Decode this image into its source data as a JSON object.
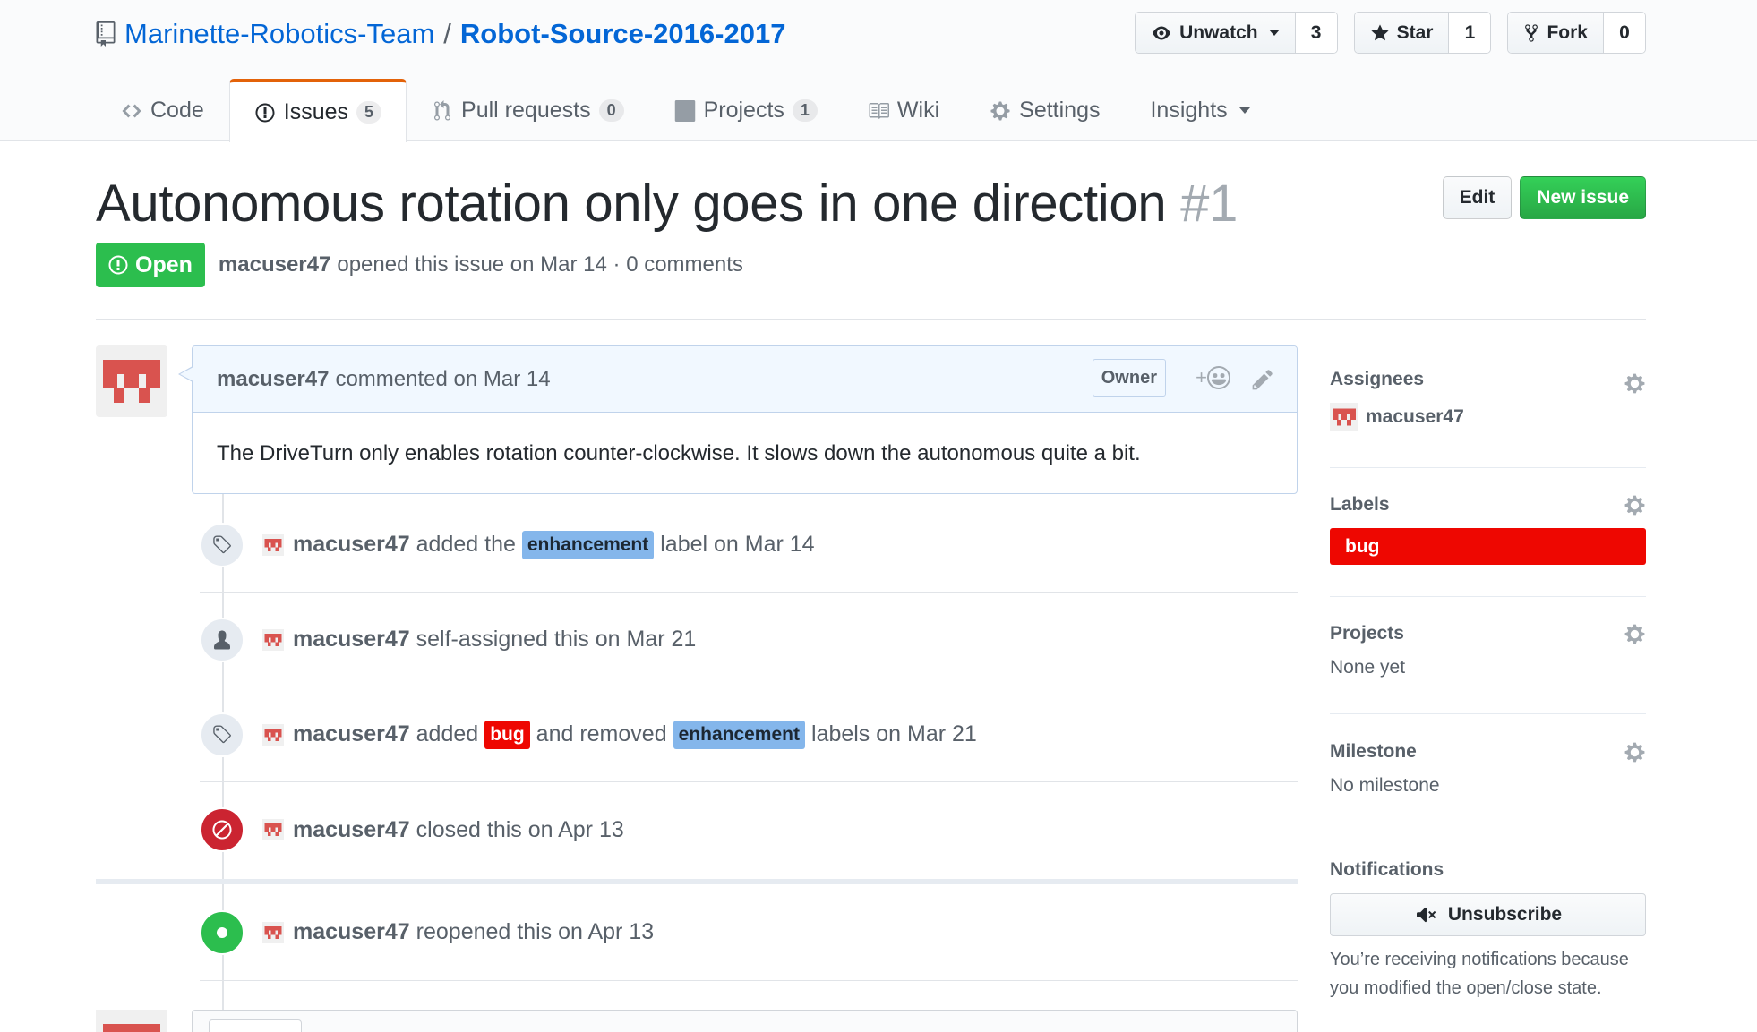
{
  "repo": {
    "owner": "Marinette-Robotics-Team",
    "separator": "/",
    "name": "Robot-Source-2016-2017"
  },
  "actions": {
    "watch_label": "Unwatch",
    "watch_count": "3",
    "star_label": "Star",
    "star_count": "1",
    "fork_label": "Fork",
    "fork_count": "0"
  },
  "nav": {
    "code": "Code",
    "issues": "Issues",
    "issues_count": "5",
    "pulls": "Pull requests",
    "pulls_count": "0",
    "projects": "Projects",
    "projects_count": "1",
    "wiki": "Wiki",
    "settings": "Settings",
    "insights": "Insights"
  },
  "issue": {
    "title": "Autonomous rotation only goes in one direction",
    "number": "#1",
    "edit_label": "Edit",
    "new_issue_label": "New issue",
    "state": "Open",
    "author": "macuser47",
    "meta_text": "opened this issue on Mar 14 · 0 comments"
  },
  "comment": {
    "author": "macuser47",
    "action": "commented on Mar 14",
    "role": "Owner",
    "reaction_plus": "+",
    "body": "The DriveTurn only enables rotation counter-clockwise. It slows down the autonomous quite a bit."
  },
  "timeline": [
    {
      "author": "macuser47",
      "t1": "added the",
      "label1": "enhancement",
      "t2": "label on Mar 14"
    },
    {
      "author": "macuser47",
      "t1": "self-assigned this on Mar 21"
    },
    {
      "author": "macuser47",
      "t1": "added",
      "label1": "bug",
      "t2": "and removed",
      "label2": "enhancement",
      "t3": "labels on Mar 21"
    },
    {
      "author": "macuser47",
      "t1": "closed this on Apr 13"
    },
    {
      "author": "macuser47",
      "t1": "reopened this on Apr 13"
    }
  ],
  "sidebar": {
    "assignees_heading": "Assignees",
    "assignee": "macuser47",
    "labels_heading": "Labels",
    "label": "bug",
    "projects_heading": "Projects",
    "projects_value": "None yet",
    "milestone_heading": "Milestone",
    "milestone_value": "No milestone",
    "notifications_heading": "Notifications",
    "unsubscribe_label": "Unsubscribe",
    "notification_note": "You’re receiving notifications because you modified the open/close state."
  },
  "colors": {
    "link": "#0366d6",
    "open_green": "#2cbe4e",
    "closed_red": "#cb2431",
    "label_bug": "#ee0701",
    "label_enhancement": "#84b6eb",
    "nav_accent": "#e36209",
    "avatar_red": "#d9534f"
  }
}
